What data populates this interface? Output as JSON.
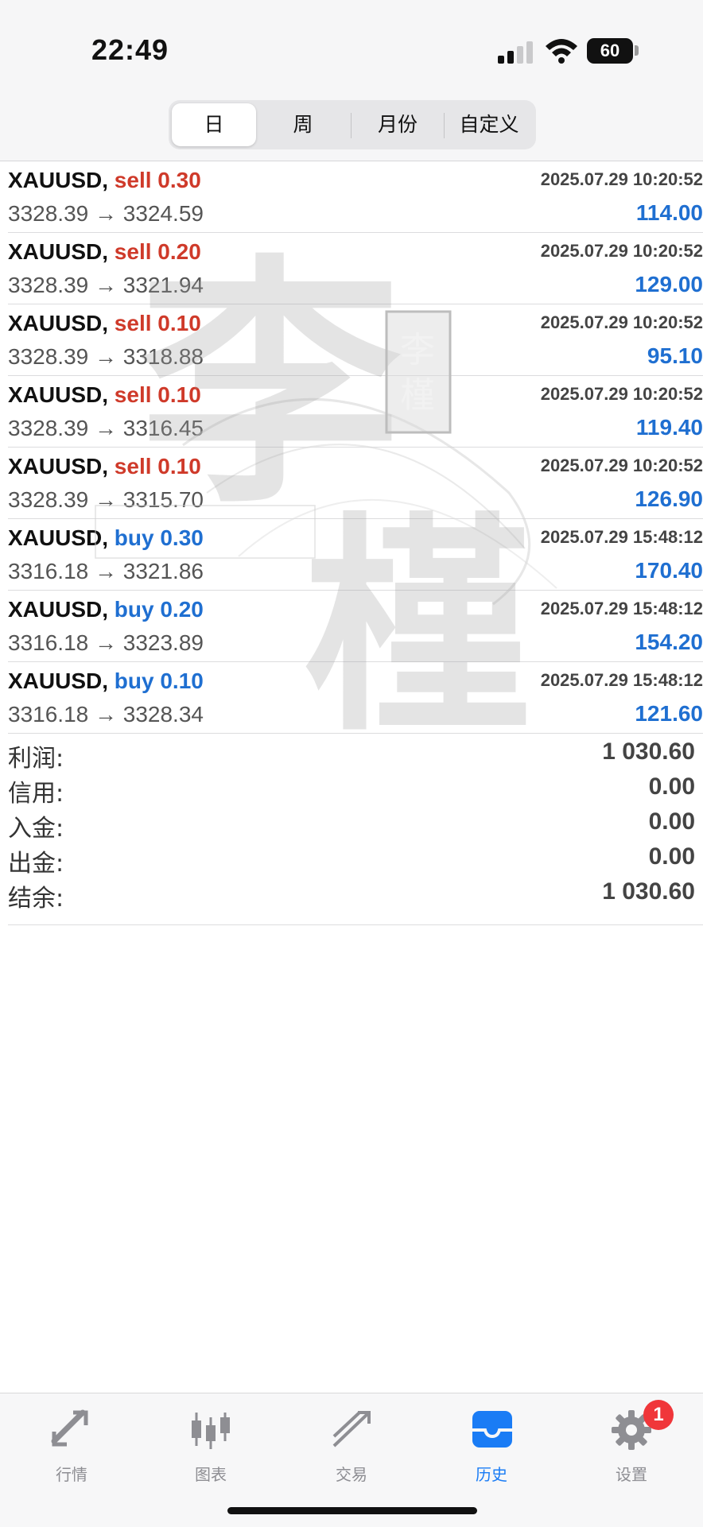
{
  "status": {
    "time": "22:49",
    "battery": "60"
  },
  "tabs_period": [
    {
      "label": "日",
      "active": true
    },
    {
      "label": "周",
      "active": false
    },
    {
      "label": "月份",
      "active": false
    },
    {
      "label": "自定义",
      "active": false
    }
  ],
  "trades": [
    {
      "symbol": "XAUUSD,",
      "side": "sell",
      "volume": "0.30",
      "time": "2025.07.29 10:20:52",
      "prices": "3328.39 → 3324.59",
      "profit": "114.00"
    },
    {
      "symbol": "XAUUSD,",
      "side": "sell",
      "volume": "0.20",
      "time": "2025.07.29 10:20:52",
      "prices": "3328.39 → 3321.94",
      "profit": "129.00"
    },
    {
      "symbol": "XAUUSD,",
      "side": "sell",
      "volume": "0.10",
      "time": "2025.07.29 10:20:52",
      "prices": "3328.39 → 3318.88",
      "profit": "95.10"
    },
    {
      "symbol": "XAUUSD,",
      "side": "sell",
      "volume": "0.10",
      "time": "2025.07.29 10:20:52",
      "prices": "3328.39 → 3316.45",
      "profit": "119.40"
    },
    {
      "symbol": "XAUUSD,",
      "side": "sell",
      "volume": "0.10",
      "time": "2025.07.29 10:20:52",
      "prices": "3328.39 → 3315.70",
      "profit": "126.90"
    },
    {
      "symbol": "XAUUSD,",
      "side": "buy",
      "volume": "0.30",
      "time": "2025.07.29 15:48:12",
      "prices": "3316.18 → 3321.86",
      "profit": "170.40"
    },
    {
      "symbol": "XAUUSD,",
      "side": "buy",
      "volume": "0.20",
      "time": "2025.07.29 15:48:12",
      "prices": "3316.18 → 3323.89",
      "profit": "154.20"
    },
    {
      "symbol": "XAUUSD,",
      "side": "buy",
      "volume": "0.10",
      "time": "2025.07.29 15:48:12",
      "prices": "3316.18 → 3328.34",
      "profit": "121.60"
    }
  ],
  "summary": [
    {
      "label": "利润:",
      "value": "1 030.60"
    },
    {
      "label": "信用:",
      "value": "0.00"
    },
    {
      "label": "入金:",
      "value": "0.00"
    },
    {
      "label": "出金:",
      "value": "0.00"
    },
    {
      "label": "结余:",
      "value": "1 030.60"
    }
  ],
  "watermark": {
    "big_chars": [
      "李",
      "槿"
    ],
    "seal_chars": [
      "李",
      "槿"
    ]
  },
  "bottom_tabs": [
    {
      "label": "行情",
      "icon": "quotes-icon",
      "active": false
    },
    {
      "label": "图表",
      "icon": "chart-candles-icon",
      "active": false
    },
    {
      "label": "交易",
      "icon": "trade-icon",
      "active": false
    },
    {
      "label": "历史",
      "icon": "history-inbox-icon",
      "active": true
    },
    {
      "label": "设置",
      "icon": "gear-icon",
      "active": false
    }
  ],
  "settings_badge": "1",
  "colors": {
    "sell": "#cf3a2a",
    "buy": "#1f6fd1",
    "active_tab": "#1a7cf5",
    "badge": "#f0363a"
  }
}
